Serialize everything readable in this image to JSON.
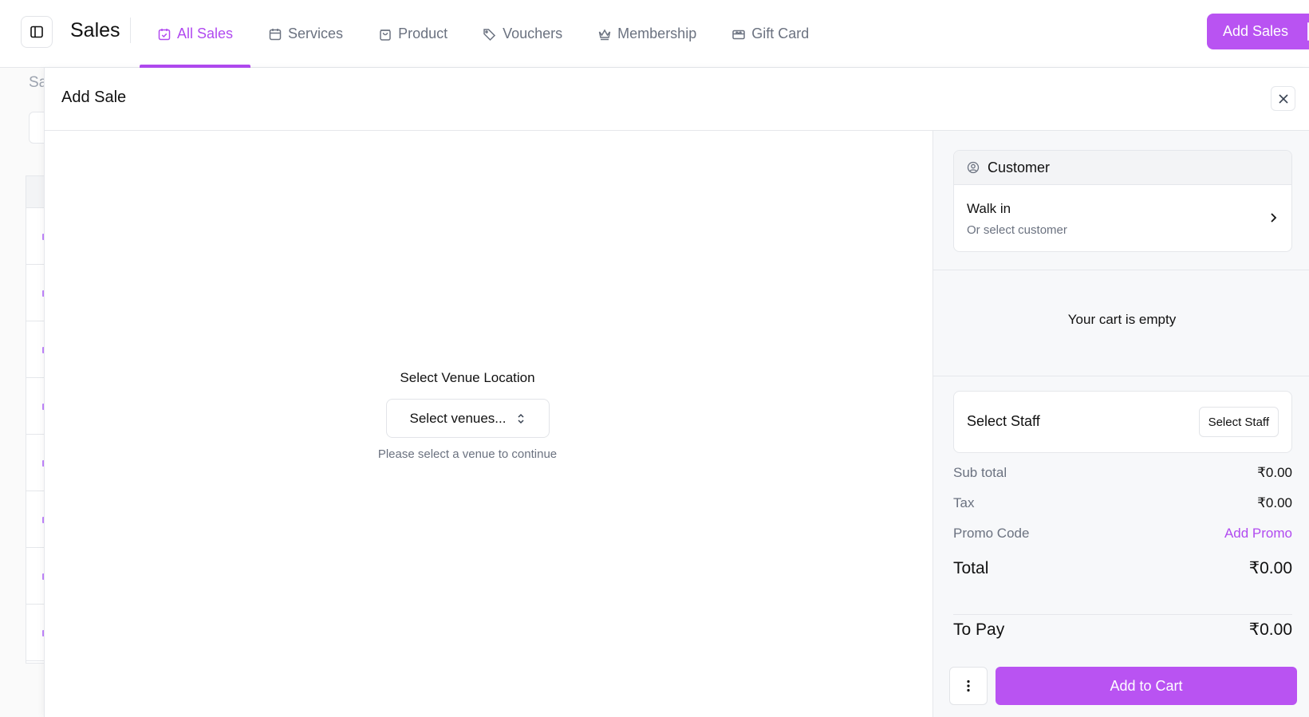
{
  "header": {
    "title": "Sales",
    "tabs": [
      {
        "label": "All Sales",
        "icon": "calendar-check-icon",
        "active": true
      },
      {
        "label": "Services",
        "icon": "calendar-icon",
        "active": false
      },
      {
        "label": "Product",
        "icon": "shopping-bag-icon",
        "active": false
      },
      {
        "label": "Vouchers",
        "icon": "tags-icon",
        "active": false
      },
      {
        "label": "Membership",
        "icon": "crown-icon",
        "active": false
      },
      {
        "label": "Gift Card",
        "icon": "gift-card-icon",
        "active": false
      }
    ],
    "add_sales_label": "Add Sales"
  },
  "background": {
    "label_fragment": "Sa"
  },
  "drawer": {
    "title": "Add Sale",
    "venue": {
      "title": "Select Venue Location",
      "placeholder": "Select venues...",
      "help": "Please select a venue to continue"
    },
    "customer": {
      "heading": "Customer",
      "name": "Walk in",
      "subtext": "Or select customer"
    },
    "cart_empty": "Your cart is empty",
    "staff": {
      "label": "Select Staff",
      "button": "Select Staff"
    },
    "summary": {
      "subtotal_label": "Sub total",
      "subtotal_value": "₹0.00",
      "tax_label": "Tax",
      "tax_value": "₹0.00",
      "promo_label": "Promo Code",
      "promo_action": "Add Promo",
      "total_label": "Total",
      "total_value": "₹0.00",
      "topay_label": "To Pay",
      "topay_value": "₹0.00"
    },
    "add_to_cart": "Add to Cart"
  },
  "colors": {
    "accent": "#b953f2",
    "accent_text": "#b14af0"
  }
}
